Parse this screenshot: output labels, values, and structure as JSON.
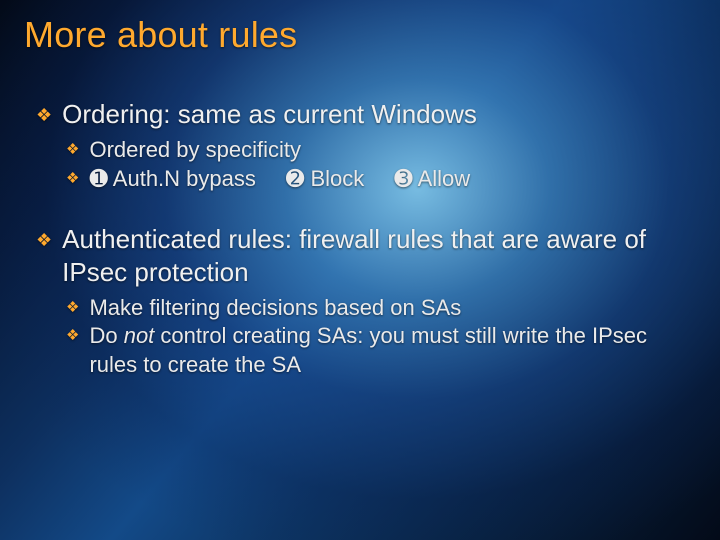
{
  "title": "More about rules",
  "bullets": [
    {
      "level": 1,
      "text": "Ordering: same as current Windows",
      "children": [
        {
          "level": 2,
          "text": "Ordered by specificity"
        },
        {
          "level": 2,
          "type": "enum3",
          "items": [
            {
              "num": "➊",
              "text": "Auth.N bypass"
            },
            {
              "num": "➋",
              "text": "Block"
            },
            {
              "num": "➌",
              "text": "Allow"
            }
          ]
        }
      ]
    },
    {
      "level": 1,
      "text": "Authenticated rules: firewall rules that are aware of IPsec protection",
      "children": [
        {
          "level": 2,
          "text": "Make filtering decisions based on SAs"
        },
        {
          "level": 2,
          "type": "rich",
          "parts": [
            {
              "t": "Do "
            },
            {
              "t": "not",
              "italic": true
            },
            {
              "t": " control creating SAs: you must still write the IPsec rules to create the SA"
            }
          ]
        }
      ]
    }
  ],
  "bullet_glyph_l1": "❖",
  "bullet_glyph_l2": "❖"
}
